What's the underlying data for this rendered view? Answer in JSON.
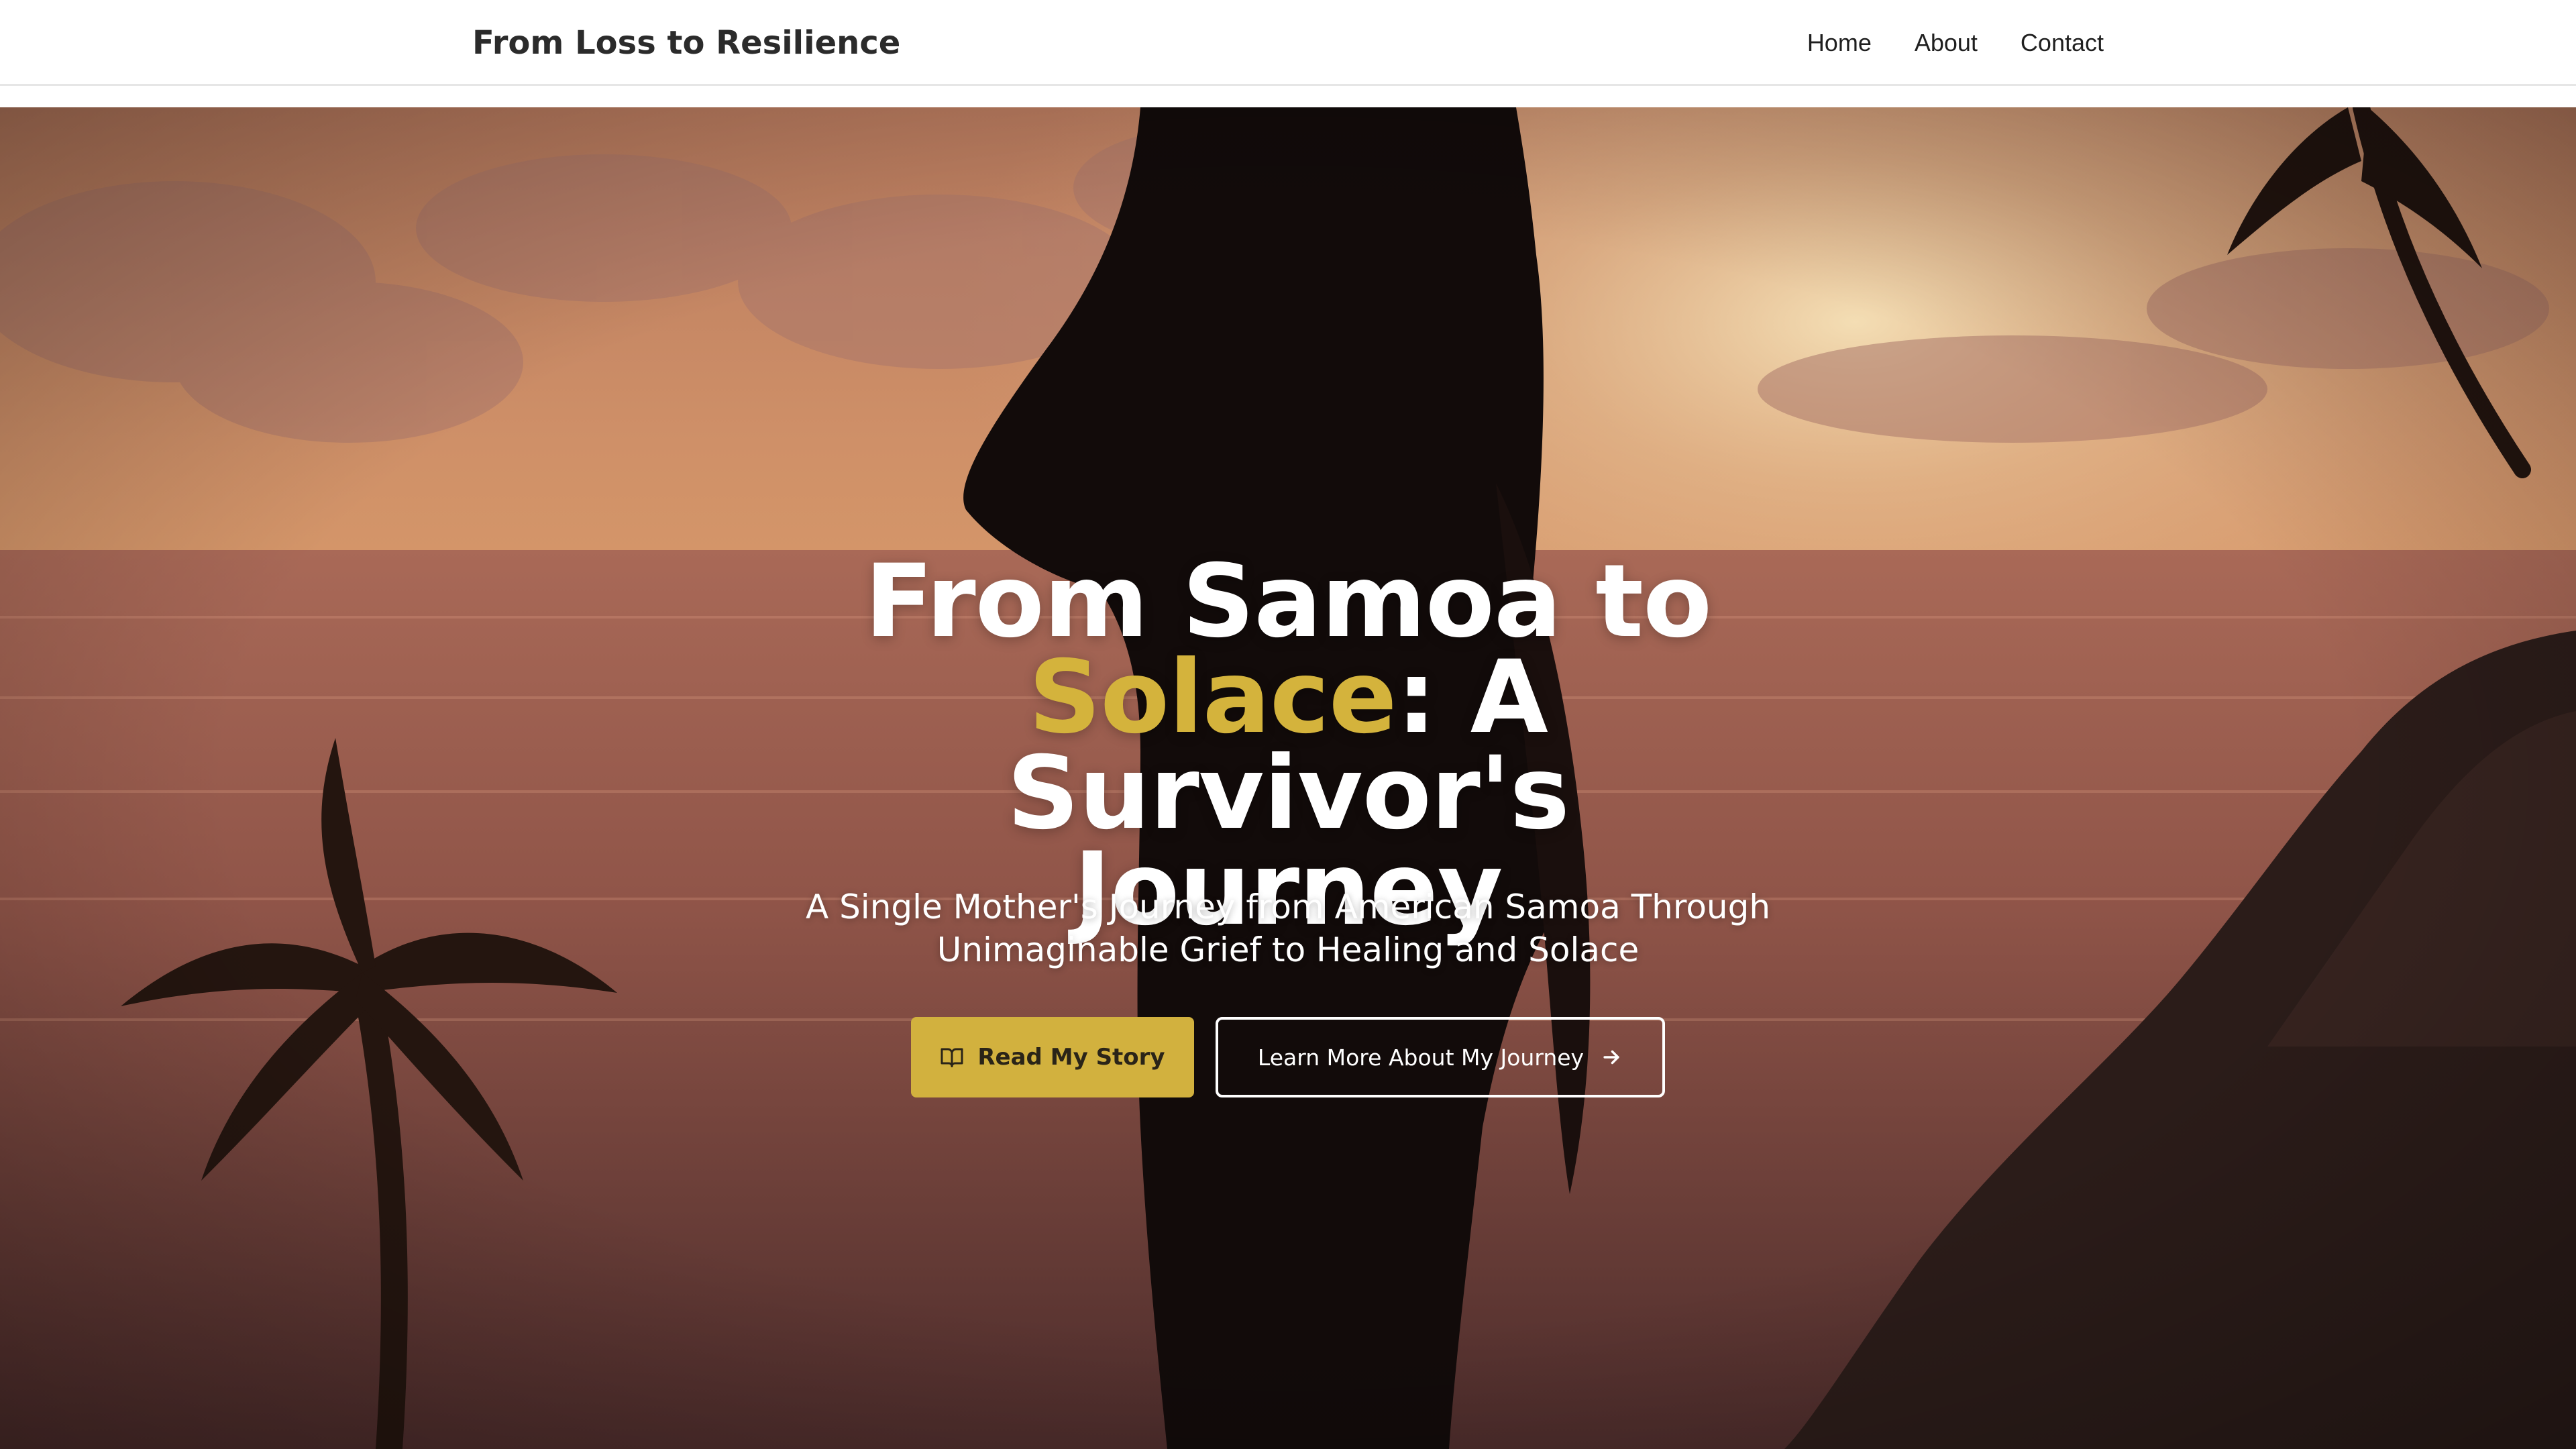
{
  "header": {
    "brand": "From Loss to Resilience",
    "nav": [
      {
        "label": "Home"
      },
      {
        "label": "About"
      },
      {
        "label": "Contact"
      }
    ]
  },
  "hero": {
    "title_line1": "From Samoa to",
    "title_accent": "Solace",
    "title_rest": ": A Survivor's",
    "title_line3": "Journey",
    "subtitle": "A Single Mother's Journey from American Samoa Through Unimaginable Grief to Healing and Solace",
    "primary_button": {
      "label": "Read My Story",
      "icon": "book-open-icon"
    },
    "secondary_button": {
      "label": "Learn More About My Journey",
      "icon": "arrow-right-icon"
    }
  },
  "colors": {
    "accent": "#d2b13e",
    "header_bg": "#ffffff",
    "brand_text": "#2b2b2b",
    "hero_text": "#ffffff"
  }
}
